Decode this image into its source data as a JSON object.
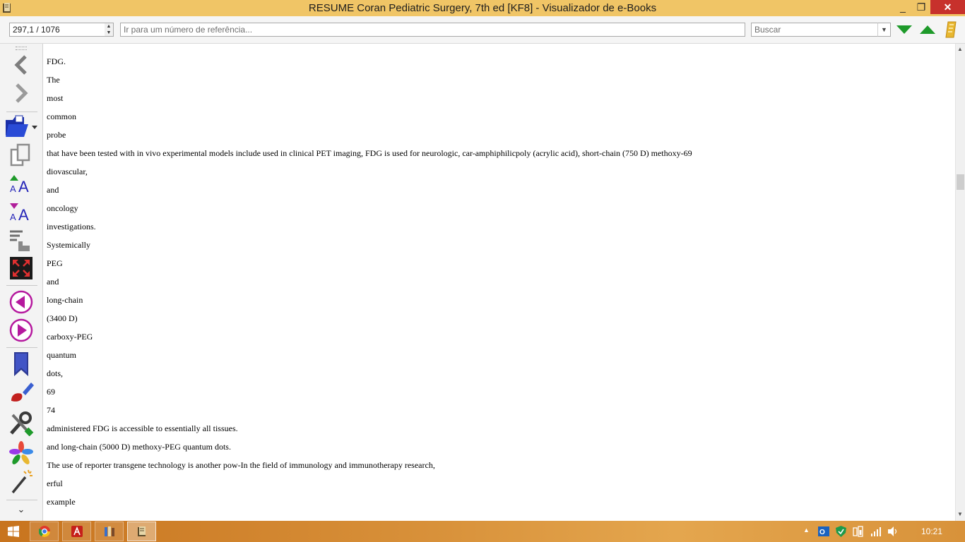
{
  "window": {
    "title": "RESUME Coran Pediatric Surgery, 7th ed [KF8] - Visualizador de e-Books",
    "minimize_label": "_",
    "restore_label": "❐",
    "close_label": "✕"
  },
  "toolbar": {
    "position_value": "297,1 / 1076",
    "reference_placeholder": "Ir para um número de referência...",
    "search_placeholder": "Buscar"
  },
  "sidebar": {
    "more_label": "⌄",
    "tools": [
      "back-icon",
      "forward-icon",
      "open-book-icon",
      "copy-icon",
      "font-larger-icon",
      "font-smaller-icon",
      "reference-mode-icon",
      "fullscreen-icon",
      "previous-page-icon",
      "next-page-icon",
      "bookmark-icon",
      "theme-brush-icon",
      "preferences-icon",
      "plugins-icon",
      "magic-wand-icon"
    ]
  },
  "content": {
    "lines": [
      "FDG.",
      "The",
      "most",
      "common",
      "probe",
      "that have been tested with in vivo experimental models include used in clinical PET imaging, FDG is used for neurologic, car-amphiphilicpoly (acrylic acid), short-chain (750 D) methoxy-69",
      "diovascular,",
      "and",
      "oncology",
      "investigations.",
      "Systemically",
      "PEG",
      "and",
      "long-chain",
      "(3400 D)",
      "carboxy-PEG",
      "quantum",
      "dots,",
      "69",
      "74",
      "administered FDG is accessible to essentially all tissues.",
      "and long-chain (5000 D) methoxy-PEG quantum dots.",
      "The use of reporter transgene technology is another pow-In the field of immunology and immunotherapy research,",
      "erful",
      "example"
    ]
  },
  "taskbar": {
    "apps": [
      "windows-start-icon",
      "chrome-icon",
      "acrobat-icon",
      "library-icon",
      "ebook-viewer-icon"
    ],
    "clock": "10:21"
  },
  "colors": {
    "titlebar": "#f0c566",
    "close": "#c7312c",
    "accent_green": "#1e9a2a",
    "taskbar": "#d8913a"
  }
}
